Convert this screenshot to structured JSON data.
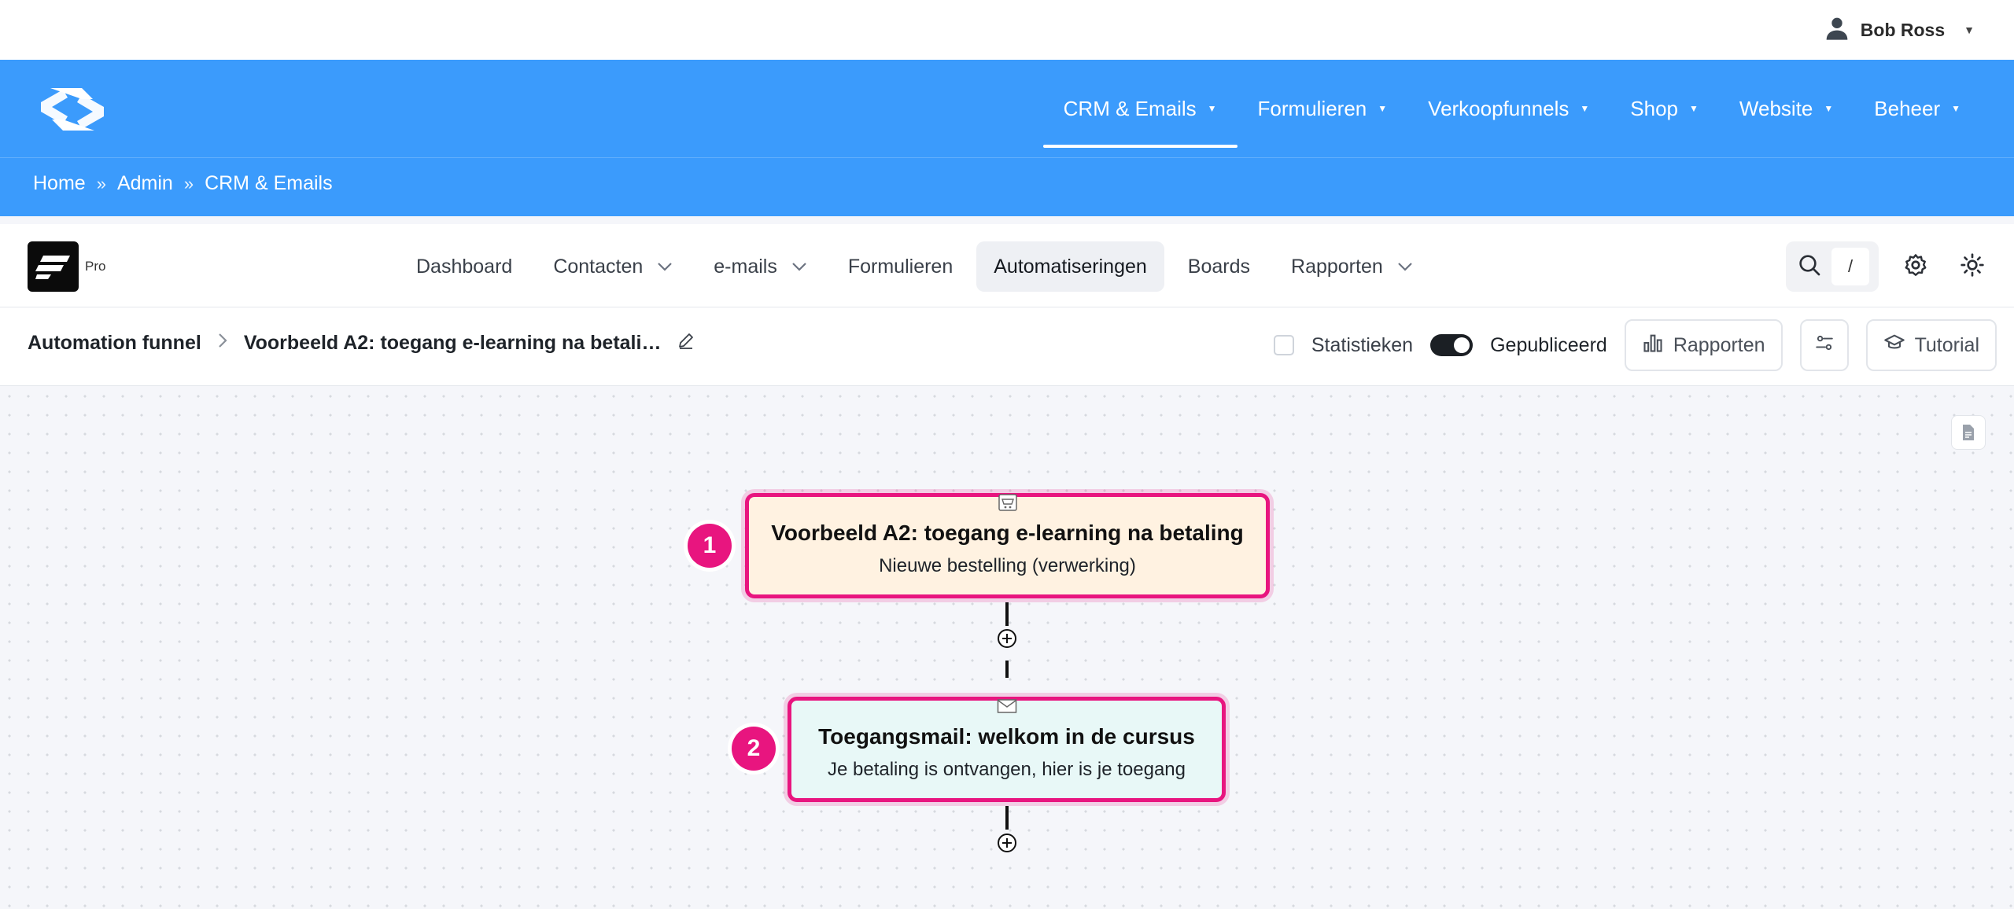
{
  "user": {
    "name": "Bob Ross"
  },
  "main_menu": [
    {
      "label": "CRM & Emails",
      "active": true
    },
    {
      "label": "Formulieren"
    },
    {
      "label": "Verkoopfunnels"
    },
    {
      "label": "Shop"
    },
    {
      "label": "Website"
    },
    {
      "label": "Beheer"
    }
  ],
  "breadcrumb": [
    "Home",
    "Admin",
    "CRM & Emails"
  ],
  "breadcrumb_sep": "»",
  "app": {
    "badge": "Pro"
  },
  "app_nav": [
    {
      "label": "Dashboard"
    },
    {
      "label": "Contacten",
      "dropdown": true
    },
    {
      "label": "e-mails",
      "dropdown": true
    },
    {
      "label": "Formulieren"
    },
    {
      "label": "Automatiseringen",
      "active": true
    },
    {
      "label": "Boards"
    },
    {
      "label": "Rapporten",
      "dropdown": true
    }
  ],
  "search": {
    "shortcut": "/"
  },
  "funnel": {
    "root": "Automation funnel",
    "name": "Voorbeeld A2: toegang e-learning na betali…",
    "stats_label": "Statistieken",
    "published_label": "Gepubliceerd",
    "reports_button": "Rapporten",
    "tutorial_button": "Tutorial"
  },
  "nodes": [
    {
      "number": "1",
      "title": "Voorbeeld A2: toegang e-learning na betaling",
      "subtitle": "Nieuwe bestelling (verwerking)",
      "icon": "shop-icon"
    },
    {
      "number": "2",
      "title": "Toegangsmail: welkom in de cursus",
      "subtitle": "Je betaling is ontvangen, hier is je toegang",
      "icon": "mail-icon"
    }
  ],
  "colors": {
    "brand_blue": "#3b9bfc",
    "node_border": "#e8157f",
    "trigger_bg": "#fff2e1",
    "action_bg": "#e8f8f7"
  }
}
